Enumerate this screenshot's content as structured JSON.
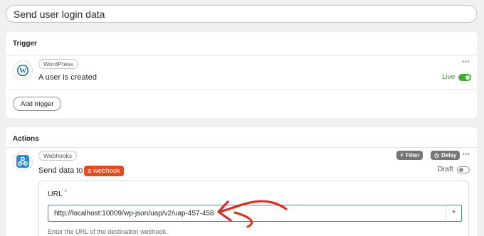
{
  "workflow": {
    "title": "Send user login data"
  },
  "trigger_card": {
    "header": "Trigger",
    "app_badge": "WordPress",
    "step_text": "A user is created",
    "more_icon": "more-horizontal-icon",
    "status_label": "Live",
    "status_on": true,
    "add_trigger_label": "Add trigger"
  },
  "actions_card": {
    "header": "Actions",
    "app_badge": "Webhooks",
    "step_prefix": "Send data to",
    "step_tag": "a webhook",
    "filter_label": "Filter",
    "delay_label": "Delay",
    "status_label": "Draft",
    "status_on": false,
    "field": {
      "label": "URL",
      "required_mark": "*",
      "value": "http://localhost:10009/wp-json/uap/v2/uap-457-458",
      "token_button": "*",
      "help": "Enter the URL of the destination webhook."
    }
  },
  "colors": {
    "accent_live": "#3fae2a",
    "webhook_tag": "#e8491d",
    "annotation_arrow": "#e02a1a",
    "input_focus": "#4b7be5"
  }
}
